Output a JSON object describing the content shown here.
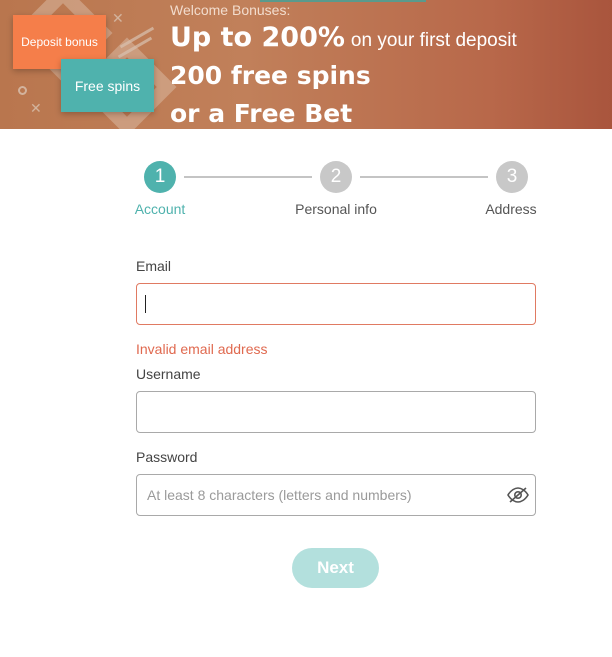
{
  "banner": {
    "welcome": "Welcome Bonuses:",
    "line1_big": "Up to 200%",
    "line1_small": "on your first deposit",
    "line2": "200 free spins",
    "line3": "or a Free Bet",
    "cards": {
      "deposit": "Deposit bonus",
      "spins": "Free spins"
    }
  },
  "stepper": {
    "steps": [
      {
        "number": "1",
        "label": "Account",
        "active": true
      },
      {
        "number": "2",
        "label": "Personal info",
        "active": false
      },
      {
        "number": "3",
        "label": "Address",
        "active": false
      }
    ]
  },
  "form": {
    "email": {
      "label": "Email",
      "value": "",
      "error": "Invalid email address"
    },
    "username": {
      "label": "Username",
      "value": ""
    },
    "password": {
      "label": "Password",
      "placeholder": "At least 8 characters (letters and numbers)",
      "toggle_icon": "eye-slash-icon"
    },
    "next_label": "Next"
  },
  "colors": {
    "accent": "#4fb2ad",
    "accent_disabled": "#b3e0dd",
    "error": "#e0694f",
    "orange_card": "#f57e4a",
    "banner_bg": "#b9764e"
  }
}
